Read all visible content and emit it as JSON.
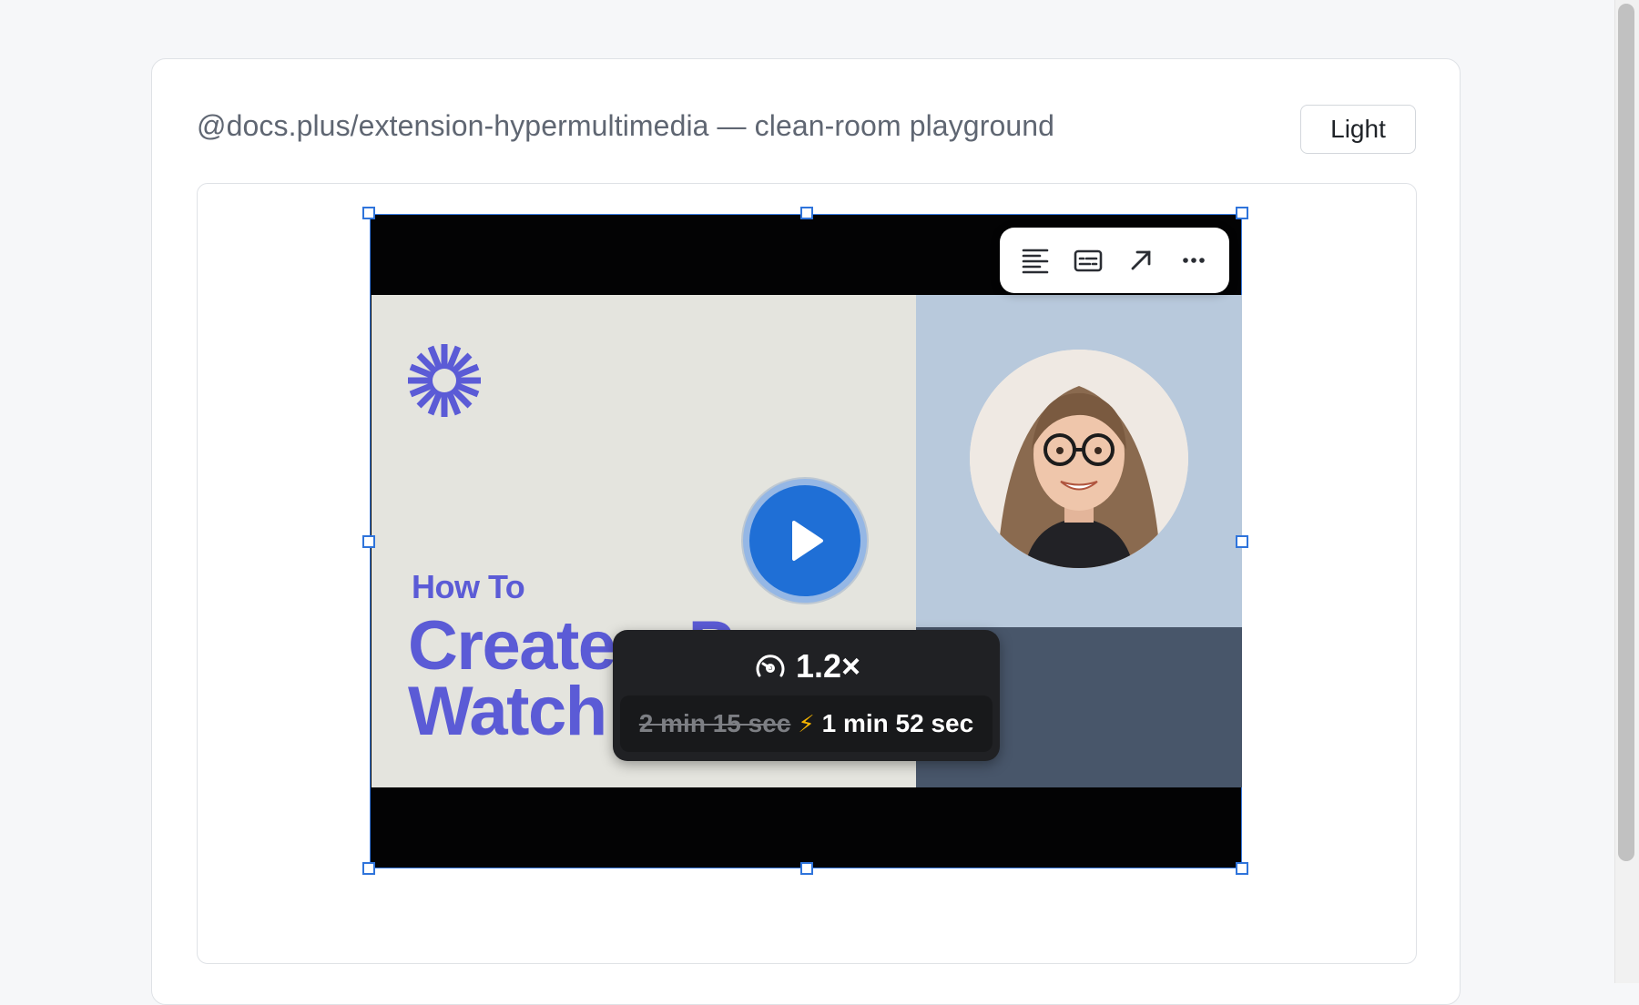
{
  "header": {
    "title": "@docs.plus/extension-hypermultimedia — clean-room playground",
    "theme_button_label": "Light"
  },
  "media_toolbar": {
    "items": [
      {
        "icon": "align-left-icon"
      },
      {
        "icon": "captions-icon"
      },
      {
        "icon": "open-external-icon"
      },
      {
        "icon": "more-options-icon"
      }
    ]
  },
  "video": {
    "poster_eyebrow": "How To",
    "poster_headline": "Create a P\nWatch v",
    "play_icon": "play-icon",
    "speed": "1.2×",
    "original_duration": "2 min 15 sec",
    "adjusted_duration": "1 min 52 sec",
    "bolt": "⚡"
  },
  "colors": {
    "selection_outline": "#3a7be0",
    "play_button": "#1f6fd6",
    "poster_accent": "#5b5bd6",
    "speed_card": "#202124"
  }
}
